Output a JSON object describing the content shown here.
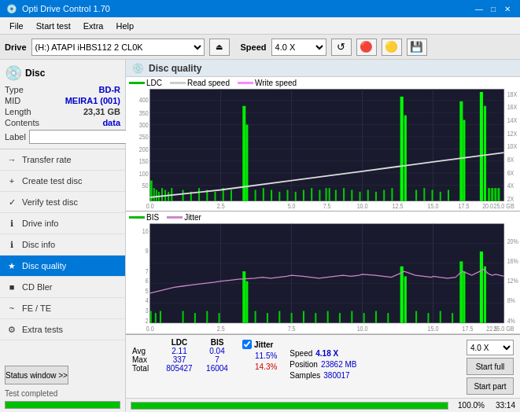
{
  "titleBar": {
    "title": "Opti Drive Control 1.70",
    "minBtn": "—",
    "maxBtn": "□",
    "closeBtn": "✕"
  },
  "menuBar": {
    "items": [
      "File",
      "Start test",
      "Extra",
      "Help"
    ]
  },
  "driveBar": {
    "driveLabel": "Drive",
    "driveValue": "(H:) ATAPI iHBS112  2 CL0K",
    "speedLabel": "Speed",
    "speedValue": "4.0 X"
  },
  "disc": {
    "title": "Disc",
    "typeLabel": "Type",
    "typeValue": "BD-R",
    "midLabel": "MID",
    "midValue": "MEIRA1 (001)",
    "lengthLabel": "Length",
    "lengthValue": "23,31 GB",
    "contentsLabel": "Contents",
    "contentsValue": "data",
    "labelLabel": "Label"
  },
  "navItems": [
    {
      "label": "Transfer rate",
      "icon": "→",
      "active": false
    },
    {
      "label": "Create test disc",
      "icon": "+",
      "active": false
    },
    {
      "label": "Verify test disc",
      "icon": "✓",
      "active": false
    },
    {
      "label": "Drive info",
      "icon": "i",
      "active": false
    },
    {
      "label": "Disc info",
      "icon": "i",
      "active": false
    },
    {
      "label": "Disc quality",
      "icon": "★",
      "active": true
    },
    {
      "label": "CD Bler",
      "icon": "■",
      "active": false
    },
    {
      "label": "FE / TE",
      "icon": "~",
      "active": false
    },
    {
      "label": "Extra tests",
      "icon": "⚙",
      "active": false
    }
  ],
  "statusBtn": "Status window >>",
  "statusText": "Test completed",
  "progressPercent": 100,
  "progressLabel": "100.0%",
  "panelHeader": {
    "title": "Disc quality"
  },
  "chart1": {
    "title": "LDC chart",
    "legend": [
      {
        "label": "LDC",
        "color": "#00bb00"
      },
      {
        "label": "Read speed",
        "color": "#ffffff"
      },
      {
        "label": "Write speed",
        "color": "#ff00ff"
      }
    ],
    "yMax": 400,
    "xMax": 25,
    "yLabelsRight": [
      "18X",
      "16X",
      "14X",
      "12X",
      "10X",
      "8X",
      "6X",
      "4X",
      "2X"
    ]
  },
  "chart2": {
    "title": "BIS/Jitter chart",
    "legend": [
      {
        "label": "BIS",
        "color": "#00bb00"
      },
      {
        "label": "Jitter",
        "color": "#cc88cc"
      }
    ],
    "yMax": 10,
    "xMax": 25,
    "yLabelsRight": [
      "20%",
      "16%",
      "12%",
      "8%",
      "4%"
    ]
  },
  "stats": {
    "columns": [
      "LDC",
      "BIS"
    ],
    "jitterLabel": "Jitter",
    "jitterChecked": true,
    "rows": [
      {
        "label": "Avg",
        "ldc": "2.11",
        "bis": "0.04",
        "jitter": "11.5%"
      },
      {
        "label": "Max",
        "ldc": "337",
        "bis": "7",
        "jitter": "14.3%"
      },
      {
        "label": "Total",
        "ldc": "805427",
        "bis": "16004",
        "jitter": ""
      }
    ],
    "speedLabel": "Speed",
    "speedValue": "4.18 X",
    "speedSelect": "4.0 X",
    "positionLabel": "Position",
    "positionValue": "23862 MB",
    "samplesLabel": "Samples",
    "samplesValue": "380017",
    "startFullLabel": "Start full",
    "startPartLabel": "Start part"
  },
  "bottomBar": {
    "progressValue": 100,
    "time": "33:14"
  }
}
